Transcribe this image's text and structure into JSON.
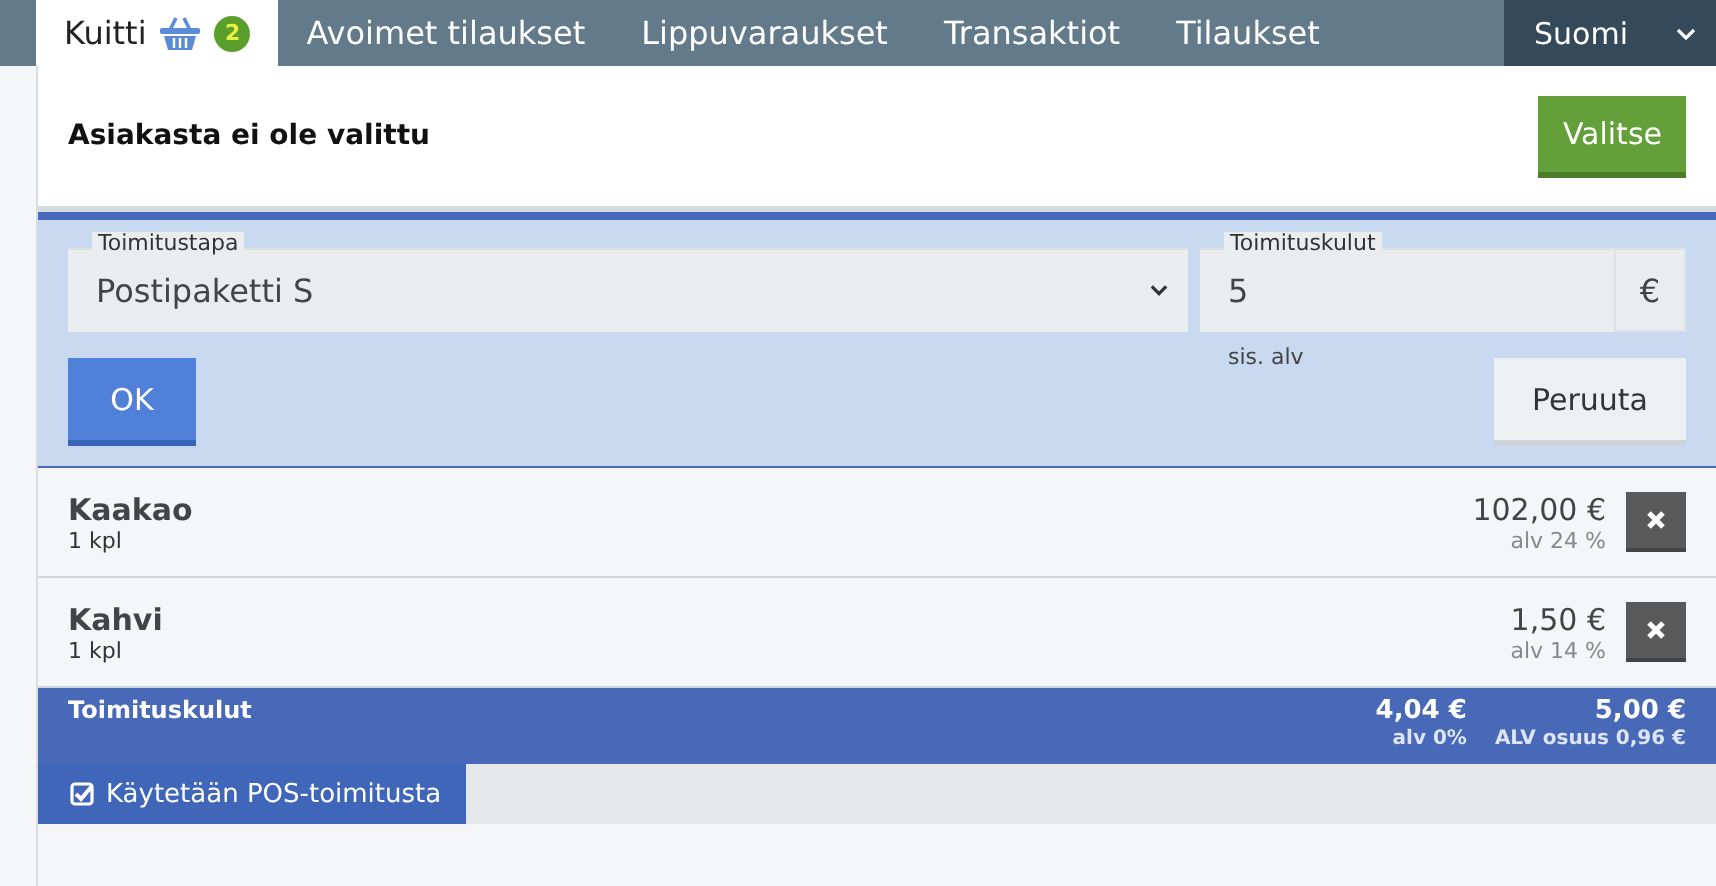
{
  "tabs": [
    {
      "label": "Kuitti",
      "selected": true,
      "badge": "2"
    },
    {
      "label": "Avoimet tilaukset",
      "selected": false
    },
    {
      "label": "Lippuvaraukset",
      "selected": false
    },
    {
      "label": "Transaktiot",
      "selected": false
    },
    {
      "label": "Tilaukset",
      "selected": false
    }
  ],
  "language": "Suomi",
  "customer": {
    "text": "Asiakasta ei ole valittu",
    "button": "Valitse"
  },
  "delivery_form": {
    "method_label": "Toimitustapa",
    "method_value": "Postipaketti S",
    "cost_label": "Toimituskulut",
    "cost_value": "5",
    "currency": "€",
    "cost_note": "sis. alv",
    "ok": "OK",
    "cancel": "Peruuta"
  },
  "items": [
    {
      "name": "Kaakao",
      "quantity": "1 kpl",
      "price": "102,00 €",
      "vat": "alv 24 %"
    },
    {
      "name": "Kahvi",
      "quantity": "1 kpl",
      "price": "1,50 €",
      "vat": "alv 14 %"
    }
  ],
  "shipping": {
    "label": "Toimituskulut",
    "net": "4,04 €",
    "net_vat": "alv 0%",
    "total": "5,00 €",
    "vat_share": "ALV osuus 0,96 €"
  },
  "pos_delivery": {
    "label": "Käytetään POS-toimitusta",
    "checked": true
  }
}
